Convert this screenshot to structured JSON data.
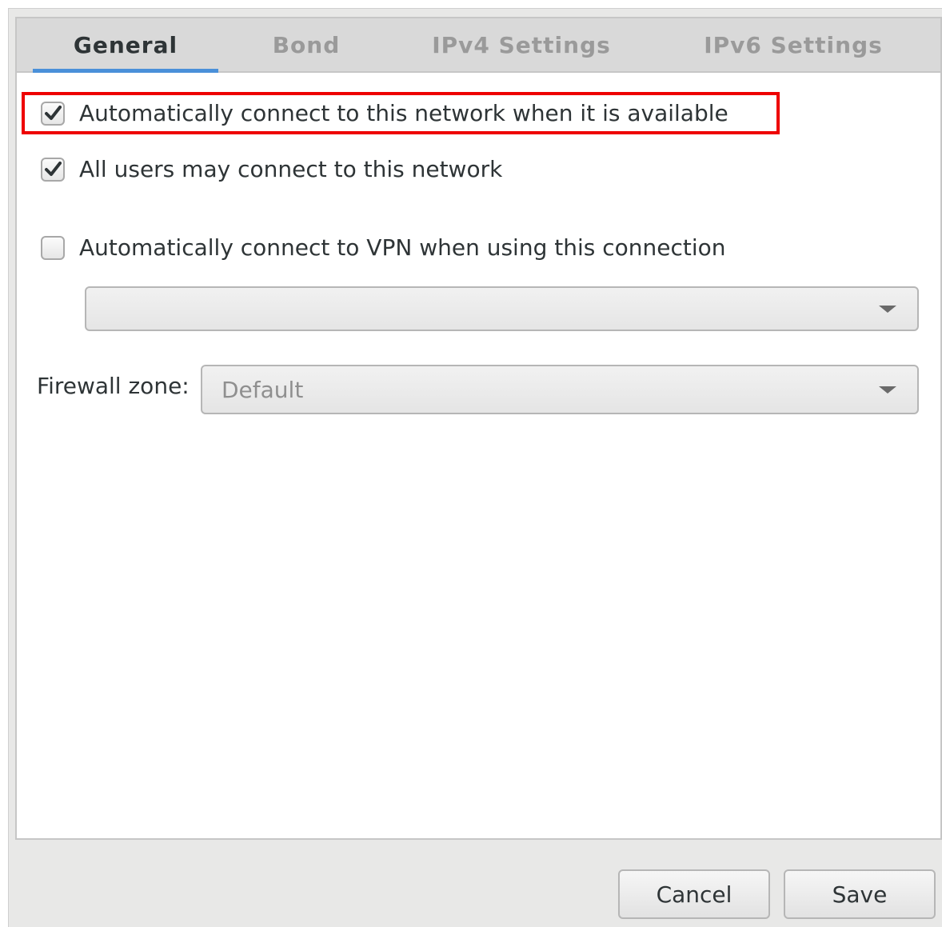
{
  "tabs": [
    {
      "label": "General",
      "active": true
    },
    {
      "label": "Bond",
      "active": false
    },
    {
      "label": "IPv4 Settings",
      "active": false
    },
    {
      "label": "IPv6 Settings",
      "active": false
    }
  ],
  "options": {
    "auto_connect": {
      "label": "Automatically connect to this network when it is available",
      "checked": true
    },
    "all_users": {
      "label": "All users may connect to this network",
      "checked": true
    },
    "auto_vpn": {
      "label": "Automatically connect to VPN when using this connection",
      "checked": false
    }
  },
  "vpn_select": {
    "value": ""
  },
  "firewall": {
    "label": "Firewall zone:",
    "value": "Default"
  },
  "buttons": {
    "cancel": "Cancel",
    "save": "Save"
  },
  "colors": {
    "highlight": "#ee0000",
    "active_tab_indicator": "#4a90d9"
  }
}
